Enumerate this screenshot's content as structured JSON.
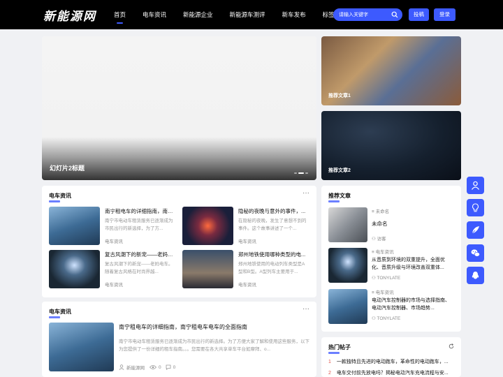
{
  "site": {
    "logo": "新能源网"
  },
  "nav": [
    "首页",
    "电车资讯",
    "新能源企业",
    "新能源车测评",
    "新车发布",
    "标签"
  ],
  "search": {
    "placeholder": "请输入关键字"
  },
  "header_buttons": {
    "submit": "投稿",
    "login": "登录"
  },
  "slider": {
    "caption": "幻灯片2标题"
  },
  "recommend_cards": [
    "推荐文章1",
    "推荐文章2"
  ],
  "section1": {
    "title": "电车资讯",
    "more": "···",
    "items": [
      {
        "title": "南宁租电车的详细指南，南宁...",
        "desc": "南宁市电动车租赁服务已逐渐成为市民出行的新选择，为了方...",
        "cat": "电车资讯"
      },
      {
        "title": "隐秘的夜晚与意外的事件，...",
        "desc": "在隐秘的夜晚，发生了意想不到的事件。这个故事讲述了一个...",
        "cat": "电车资讯"
      },
      {
        "title": "复古风潮下的新宠——老妈电...",
        "desc": "复古风潮下的新宠——老妈电车。随着复古风格在时尚界越...",
        "cat": "电车资讯"
      },
      {
        "title": "郑州地铁使用哪种类型的电...",
        "desc": "郑州地铁使用的电动列车类型是A型和B型。A型列车主要用于...",
        "cat": "电车资讯"
      }
    ]
  },
  "section2": {
    "title": "电车资讯",
    "more": "···",
    "item": {
      "title": "南宁租电车的详细指南，南宁租电车电车的全面指南",
      "desc": "南宁市电动车租赁服务已逐渐成为市民出行的新选择。为了方便大家了解和使用这些服务，以下为您提供了一份详细的租车指南。。。您需要在各大共享单车平台如摩拜、o...",
      "author": "新能源网",
      "views": "0",
      "comments": "0"
    }
  },
  "recommend": {
    "title": "推荐文章",
    "items": [
      {
        "cat": "未命名",
        "title": "未命名",
        "author": "访客"
      },
      {
        "cat": "电车资讯",
        "title": "从音质到环境的双重提升，全面优化、音质升级与环境改善双重体...",
        "author": "TONYLATE"
      },
      {
        "cat": "电车资讯",
        "title": "电动汽车控制器的市场与选择指南、电动汽车控制器、市场趋势...",
        "author": "TONYLATE"
      }
    ]
  },
  "hot": {
    "title": "热门帖子",
    "items": [
      {
        "num": "1",
        "text": "一款独特且先进的电动跑车，革命性的电动跑车，..."
      },
      {
        "num": "2",
        "text": "电车交付前先放电吗？揭秘电动汽车充电流程与安..."
      }
    ]
  },
  "colors": {
    "accent": "#3d5afe",
    "header_bg": "#000000",
    "page_bg": "#f0f1f4"
  }
}
